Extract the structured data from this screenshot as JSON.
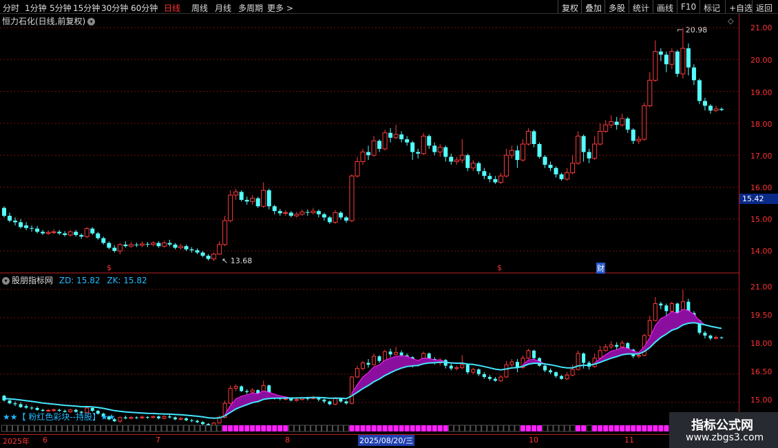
{
  "toolbar": {
    "periods": [
      "分时",
      "1分钟",
      "5分钟",
      "15分钟",
      "30分钟",
      "60分钟",
      "日线",
      "周线",
      "月线",
      "多周期",
      "更多 >"
    ],
    "active_period": "日线",
    "right_buttons": [
      "复权",
      "叠加",
      "多股",
      "统计",
      "画线",
      "F10",
      "标记",
      "+自选",
      "返回"
    ]
  },
  "main_chart": {
    "title": "恒力石化(日线,前复权)",
    "y_ticks": [
      "21.00",
      "20.00",
      "19.00",
      "18.00",
      "17.00",
      "16.00",
      "15.00",
      "14.00"
    ],
    "current_price": "15.42",
    "high_label": "20.98",
    "low_label": "13.68",
    "markers": [
      "$",
      "$",
      "财"
    ]
  },
  "indicator": {
    "name": "股朋指标网",
    "zd_label": "ZD: 15.82",
    "zk_label": "ZK: 15.82",
    "y_ticks": [
      "21.00",
      "19.50",
      "18.00",
      "16.50",
      "15.00"
    ],
    "legend_text": "★★【 粉红色彩块--持股】★★"
  },
  "date_axis": {
    "labels": [
      "2025年",
      "6",
      "7",
      "8",
      "10",
      "11"
    ],
    "highlight": "2025/08/20/三"
  },
  "watermark": {
    "title": "指标公式网",
    "url": "www.zbgs3.com"
  },
  "colors": {
    "up": "#ff3c3c",
    "down": "#54ffff",
    "band": "#8b0f9e",
    "grid": "#7a1010",
    "magenta": "#ff22ff"
  },
  "chart_data": {
    "type": "candlestick",
    "ylim": [
      13.5,
      21.3
    ],
    "candles": [
      [
        15.35,
        15.1,
        15.4,
        15.05
      ],
      [
        15.1,
        14.95,
        15.2,
        14.9
      ],
      [
        14.95,
        14.9,
        15.05,
        14.8
      ],
      [
        14.9,
        14.75,
        15.0,
        14.7
      ],
      [
        14.8,
        14.72,
        14.9,
        14.65
      ],
      [
        14.72,
        14.7,
        14.8,
        14.6
      ],
      [
        14.7,
        14.6,
        14.78,
        14.55
      ],
      [
        14.6,
        14.55,
        14.66,
        14.5
      ],
      [
        14.55,
        14.58,
        14.65,
        14.5
      ],
      [
        14.58,
        14.6,
        14.68,
        14.52
      ],
      [
        14.6,
        14.55,
        14.66,
        14.5
      ],
      [
        14.55,
        14.5,
        14.62,
        14.45
      ],
      [
        14.5,
        14.6,
        14.66,
        14.45
      ],
      [
        14.6,
        14.5,
        14.66,
        14.45
      ],
      [
        14.5,
        14.45,
        14.55,
        14.38
      ],
      [
        14.45,
        14.7,
        14.75,
        14.4
      ],
      [
        14.7,
        14.55,
        14.75,
        14.5
      ],
      [
        14.55,
        14.4,
        14.6,
        14.35
      ],
      [
        14.4,
        14.25,
        14.45,
        14.2
      ],
      [
        14.25,
        14.1,
        14.3,
        14.05
      ],
      [
        14.1,
        14.0,
        14.18,
        13.95
      ],
      [
        14.0,
        14.2,
        14.25,
        13.9
      ],
      [
        14.2,
        14.15,
        14.3,
        14.1
      ],
      [
        14.15,
        14.2,
        14.28,
        14.1
      ],
      [
        14.2,
        14.18,
        14.26,
        14.12
      ],
      [
        14.18,
        14.22,
        14.3,
        14.12
      ],
      [
        14.22,
        14.2,
        14.28,
        14.12
      ],
      [
        14.2,
        14.25,
        14.3,
        14.15
      ],
      [
        14.25,
        14.15,
        14.3,
        14.1
      ],
      [
        14.15,
        14.25,
        14.32,
        14.1
      ],
      [
        14.25,
        14.2,
        14.35,
        14.15
      ],
      [
        14.2,
        14.1,
        14.25,
        14.05
      ],
      [
        14.1,
        14.15,
        14.22,
        14.05
      ],
      [
        14.15,
        14.05,
        14.2,
        14.0
      ],
      [
        14.05,
        14.02,
        14.12,
        13.95
      ],
      [
        14.02,
        13.95,
        14.08,
        13.9
      ],
      [
        13.95,
        13.85,
        14.0,
        13.8
      ],
      [
        13.85,
        13.75,
        13.9,
        13.7
      ],
      [
        13.75,
        13.9,
        13.95,
        13.68
      ],
      [
        13.9,
        14.2,
        14.3,
        13.88
      ],
      [
        14.2,
        14.95,
        15.1,
        14.15
      ],
      [
        14.95,
        15.75,
        15.9,
        14.9
      ],
      [
        15.75,
        15.85,
        15.95,
        15.6
      ],
      [
        15.85,
        15.6,
        15.9,
        15.55
      ],
      [
        15.6,
        15.55,
        15.7,
        15.45
      ],
      [
        15.55,
        15.65,
        15.75,
        15.45
      ],
      [
        15.65,
        15.4,
        15.7,
        15.35
      ],
      [
        15.4,
        15.9,
        16.15,
        15.35
      ],
      [
        15.9,
        15.4,
        15.95,
        15.3
      ],
      [
        15.4,
        15.25,
        15.45,
        15.15
      ],
      [
        15.25,
        15.18,
        15.32,
        15.1
      ],
      [
        15.18,
        15.2,
        15.28,
        15.1
      ],
      [
        15.2,
        15.1,
        15.25,
        15.05
      ],
      [
        15.1,
        15.15,
        15.22,
        15.05
      ],
      [
        15.15,
        15.22,
        15.3,
        15.1
      ],
      [
        15.22,
        15.2,
        15.3,
        15.1
      ],
      [
        15.2,
        15.25,
        15.35,
        15.15
      ],
      [
        15.25,
        15.15,
        15.3,
        15.05
      ],
      [
        15.15,
        15.05,
        15.2,
        14.95
      ],
      [
        15.05,
        14.9,
        15.1,
        14.85
      ],
      [
        14.9,
        15.2,
        15.28,
        14.85
      ],
      [
        15.2,
        15.05,
        15.25,
        14.98
      ],
      [
        15.05,
        14.95,
        15.1,
        14.88
      ],
      [
        14.95,
        16.35,
        16.4,
        14.9
      ],
      [
        16.35,
        16.8,
        16.95,
        16.3
      ],
      [
        16.8,
        17.1,
        17.2,
        16.7
      ],
      [
        17.1,
        17.0,
        17.3,
        16.85
      ],
      [
        17.0,
        17.45,
        17.6,
        16.95
      ],
      [
        17.45,
        17.2,
        17.5,
        17.1
      ],
      [
        17.2,
        17.7,
        17.8,
        17.15
      ],
      [
        17.7,
        17.55,
        17.85,
        17.4
      ],
      [
        17.55,
        17.65,
        17.95,
        17.5
      ],
      [
        17.65,
        17.5,
        17.75,
        17.4
      ],
      [
        17.5,
        17.4,
        17.6,
        17.3
      ],
      [
        17.4,
        17.1,
        17.45,
        16.85
      ],
      [
        17.1,
        17.05,
        17.2,
        16.9
      ],
      [
        17.05,
        17.6,
        17.7,
        17.0
      ],
      [
        17.6,
        17.3,
        17.65,
        17.2
      ],
      [
        17.3,
        17.1,
        17.4,
        17.0
      ],
      [
        17.1,
        17.25,
        17.35,
        16.95
      ],
      [
        17.25,
        16.95,
        17.3,
        16.8
      ],
      [
        16.95,
        16.8,
        17.05,
        16.7
      ],
      [
        16.8,
        16.85,
        16.95,
        16.7
      ],
      [
        16.85,
        17.0,
        17.5,
        16.75
      ],
      [
        17.0,
        16.6,
        17.05,
        16.5
      ],
      [
        16.6,
        16.75,
        16.85,
        16.5
      ],
      [
        16.75,
        16.5,
        16.8,
        16.4
      ],
      [
        16.5,
        16.35,
        16.6,
        16.25
      ],
      [
        16.35,
        16.25,
        16.45,
        16.15
      ],
      [
        16.25,
        16.15,
        16.35,
        16.1
      ],
      [
        16.15,
        16.35,
        16.45,
        16.1
      ],
      [
        16.35,
        17.0,
        17.2,
        16.3
      ],
      [
        17.0,
        17.15,
        17.3,
        16.9
      ],
      [
        17.15,
        16.85,
        17.3,
        16.6
      ],
      [
        16.85,
        17.35,
        17.5,
        16.8
      ],
      [
        17.35,
        17.75,
        17.85,
        17.3
      ],
      [
        17.75,
        17.35,
        17.8,
        17.25
      ],
      [
        17.35,
        16.95,
        17.4,
        16.9
      ],
      [
        16.95,
        16.7,
        17.0,
        16.6
      ],
      [
        16.7,
        16.6,
        16.8,
        16.5
      ],
      [
        16.6,
        16.4,
        16.65,
        16.3
      ],
      [
        16.4,
        16.25,
        16.45,
        16.2
      ],
      [
        16.25,
        16.45,
        16.6,
        16.2
      ],
      [
        16.45,
        16.75,
        17.0,
        16.4
      ],
      [
        16.75,
        17.6,
        17.75,
        16.7
      ],
      [
        17.6,
        17.1,
        17.65,
        16.8
      ],
      [
        17.1,
        16.9,
        17.2,
        16.75
      ],
      [
        16.9,
        17.35,
        17.6,
        16.85
      ],
      [
        17.35,
        17.75,
        18.0,
        17.3
      ],
      [
        17.75,
        17.95,
        18.1,
        17.7
      ],
      [
        17.95,
        18.05,
        18.25,
        17.85
      ],
      [
        18.05,
        17.95,
        18.2,
        17.8
      ],
      [
        17.95,
        18.15,
        18.3,
        17.9
      ],
      [
        18.15,
        17.8,
        18.2,
        17.7
      ],
      [
        17.8,
        17.45,
        17.85,
        17.35
      ],
      [
        17.45,
        17.5,
        17.6,
        17.35
      ],
      [
        17.5,
        18.55,
        18.65,
        17.45
      ],
      [
        18.55,
        19.35,
        19.6,
        18.5
      ],
      [
        19.35,
        20.25,
        20.6,
        19.3
      ],
      [
        20.25,
        20.15,
        20.35,
        19.95
      ],
      [
        20.15,
        19.85,
        20.25,
        19.6
      ],
      [
        19.85,
        20.25,
        20.35,
        19.7
      ],
      [
        20.25,
        19.55,
        20.3,
        19.45
      ],
      [
        19.55,
        20.35,
        20.98,
        19.4
      ],
      [
        20.35,
        19.75,
        20.5,
        19.5
      ],
      [
        19.75,
        19.35,
        19.85,
        19.2
      ],
      [
        19.35,
        18.7,
        19.4,
        18.6
      ],
      [
        18.7,
        18.55,
        18.8,
        18.4
      ],
      [
        18.55,
        18.4,
        18.6,
        18.3
      ],
      [
        18.4,
        18.45,
        18.55,
        18.35
      ],
      [
        18.45,
        18.42,
        18.5,
        18.38
      ]
    ]
  }
}
